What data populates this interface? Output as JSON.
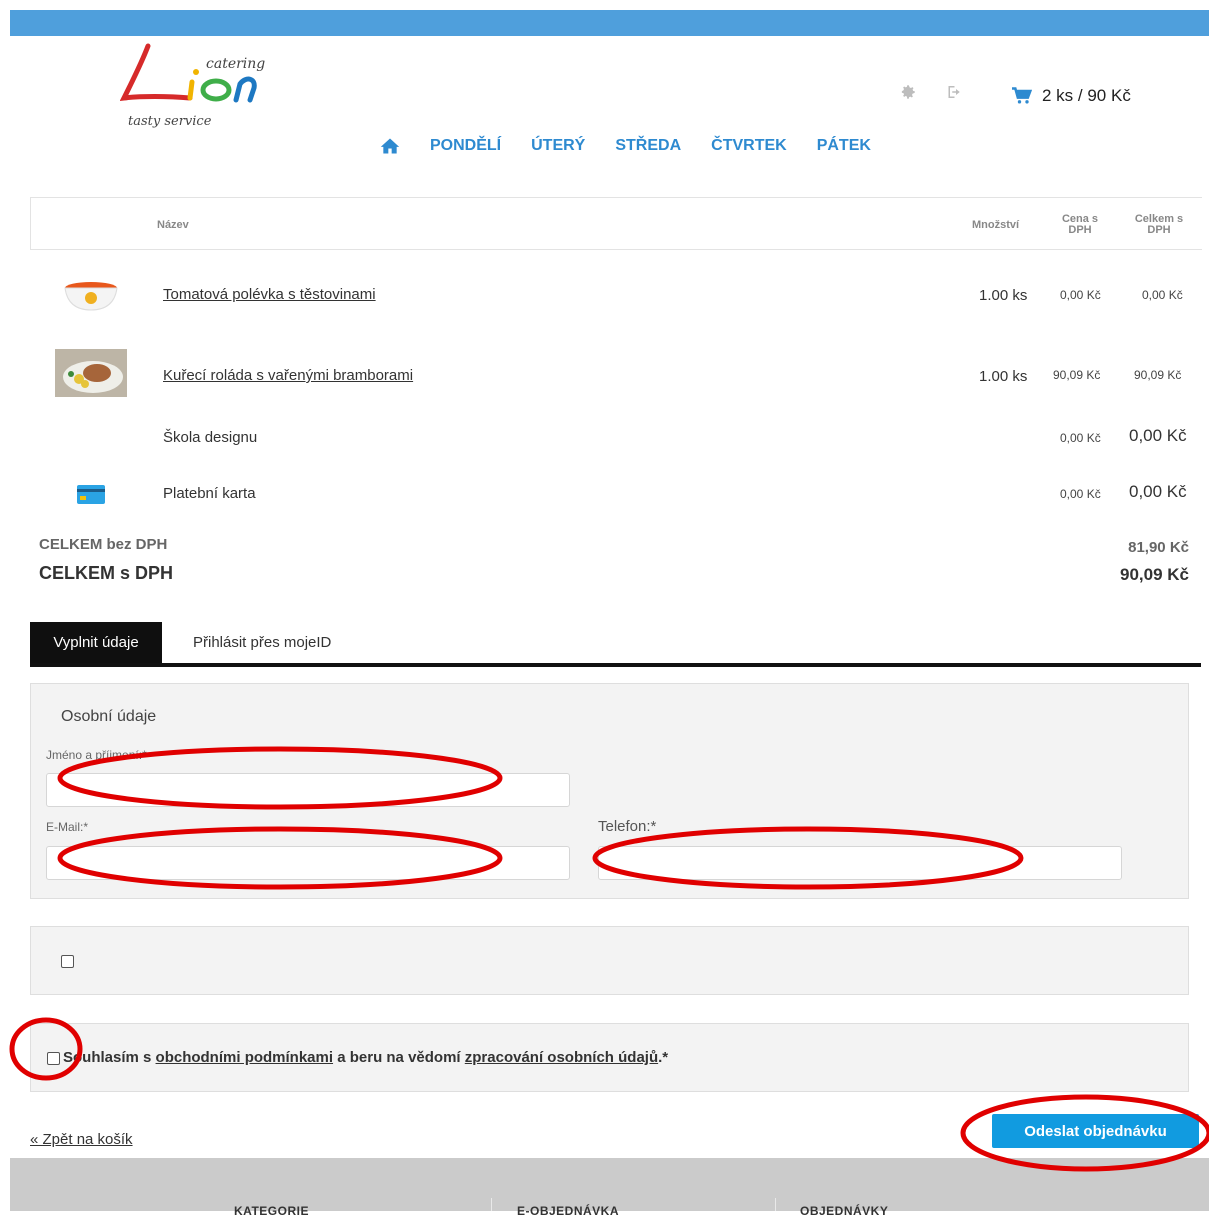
{
  "header": {
    "logo": {
      "main": "Lion",
      "sub": "catering",
      "tagline": "tasty service"
    },
    "icons": [
      "gear-icon",
      "logout-icon",
      "cart-icon"
    ],
    "cart_summary": "2 ks / 90 Kč",
    "nav": [
      "PONDĚLÍ",
      "ÚTERÝ",
      "STŘEDA",
      "ČTVRTEK",
      "PÁTEK"
    ]
  },
  "table": {
    "headers": {
      "name": "Název",
      "qty": "Množství",
      "price": "Cena s DPH",
      "total": "Celkem s DPH"
    },
    "items": [
      {
        "name": "Tomatová polévka s těstovinami",
        "qty": "1.00 ks",
        "price": "0,00 Kč",
        "total": "0,00 Kč"
      },
      {
        "name": "Kuřecí roláda s vařenými bramborami",
        "qty": "1.00 ks",
        "price": "90,09 Kč",
        "total": "90,09 Kč"
      }
    ],
    "extras": [
      {
        "name": "Škola designu",
        "price": "0,00 Kč",
        "total": "0,00 Kč"
      },
      {
        "name": "Platební karta",
        "price": "0,00 Kč",
        "total": "0,00 Kč"
      }
    ]
  },
  "totals": {
    "without_vat_label": "CELKEM bez DPH",
    "without_vat": "81,90 Kč",
    "with_vat_label": "CELKEM s DPH",
    "with_vat": "90,09 Kč"
  },
  "tabs": {
    "active": "Vyplnit údaje",
    "other": "Přihlásit přes mojeID"
  },
  "form": {
    "section_title": "Osobní údaje",
    "name_label": "Jméno a příjmení:*",
    "email_label": "E-Mail:*",
    "phone_label": "Telefon:*",
    "consent": {
      "prefix": "Souhlasím s ",
      "link1": "obchodními podmínkami",
      "middle": " a beru na vědomí ",
      "link2": "zpracování osobních údajů",
      "suffix": ".*"
    }
  },
  "actions": {
    "back": "« Zpět na košík",
    "submit": "Odeslat objednávku"
  },
  "footer": {
    "columns": [
      "KATEGORIE",
      "E-OBJEDNÁVKA",
      "OBJEDNÁVKY"
    ]
  },
  "colors": {
    "accent": "#2e8ad0",
    "topbar": "#4f9fdc",
    "button": "#119be0",
    "annotation": "#e00000"
  }
}
